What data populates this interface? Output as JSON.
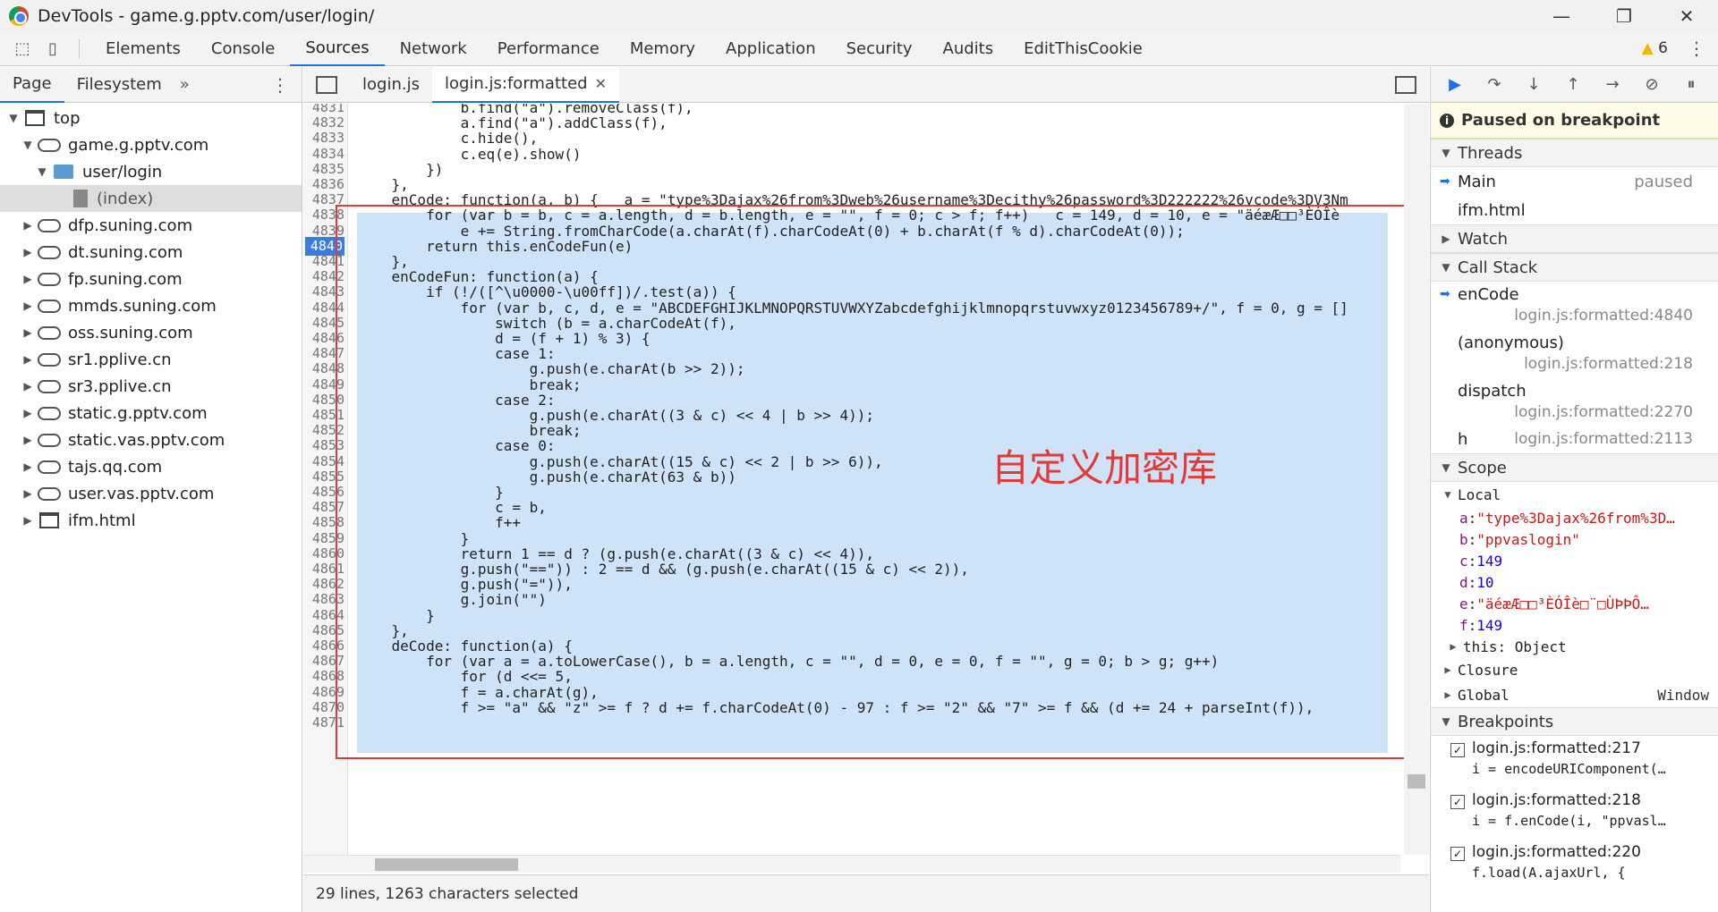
{
  "window": {
    "title": "DevTools - game.g.pptv.com/user/login/"
  },
  "main_tabs": [
    "Elements",
    "Console",
    "Sources",
    "Network",
    "Performance",
    "Memory",
    "Application",
    "Security",
    "Audits",
    "EditThisCookie"
  ],
  "active_tab": "Sources",
  "warnings": "6",
  "navigator": {
    "tabs": [
      "Page",
      "Filesystem"
    ],
    "tree": [
      {
        "label": "top",
        "level": 0,
        "kind": "frame",
        "expanded": true
      },
      {
        "label": "game.g.pptv.com",
        "level": 1,
        "kind": "cloud",
        "expanded": true
      },
      {
        "label": "user/login",
        "level": 2,
        "kind": "folder",
        "expanded": true
      },
      {
        "label": "(index)",
        "level": 3,
        "kind": "file",
        "selected": true
      },
      {
        "label": "dfp.suning.com",
        "level": 1,
        "kind": "cloud"
      },
      {
        "label": "dt.suning.com",
        "level": 1,
        "kind": "cloud"
      },
      {
        "label": "fp.suning.com",
        "level": 1,
        "kind": "cloud"
      },
      {
        "label": "mmds.suning.com",
        "level": 1,
        "kind": "cloud"
      },
      {
        "label": "oss.suning.com",
        "level": 1,
        "kind": "cloud"
      },
      {
        "label": "sr1.pplive.cn",
        "level": 1,
        "kind": "cloud"
      },
      {
        "label": "sr3.pplive.cn",
        "level": 1,
        "kind": "cloud"
      },
      {
        "label": "static.g.pptv.com",
        "level": 1,
        "kind": "cloud"
      },
      {
        "label": "static.vas.pptv.com",
        "level": 1,
        "kind": "cloud"
      },
      {
        "label": "tajs.qq.com",
        "level": 1,
        "kind": "cloud"
      },
      {
        "label": "user.vas.pptv.com",
        "level": 1,
        "kind": "cloud"
      },
      {
        "label": "ifm.html",
        "level": 1,
        "kind": "frame"
      }
    ]
  },
  "editor": {
    "tabs": [
      {
        "label": "login.js",
        "active": false
      },
      {
        "label": "login.js:formatted",
        "active": true
      }
    ],
    "first_line": 4831,
    "breakpoint_line": 4840,
    "lines": [
      "            b.find(\"a\").removeClass(f),",
      "            a.find(\"a\").addClass(f),",
      "            c.hide(),",
      "            c.eq(e).show()",
      "        })",
      "    },",
      "    enCode: function(a, b) {   a = \"type%3Dajax%26from%3Dweb%26username%3Decithy%26password%3D222222%26vcode%3DV3Nm",
      "        for (var b = b, c = a.length, d = b.length, e = \"\", f = 0; c > f; f++)   c = 149, d = 10, e = \"äéæÆ□□³ÈÓÎè",
      "            e += String.fromCharCode(a.charAt(f).charCodeAt(0) + b.charAt(f % d).charCodeAt(0));",
      "        return this.enCodeFun(e)",
      "    },",
      "    enCodeFun: function(a) {",
      "        if (!/([^\\u0000-\\u00ff])/.test(a)) {",
      "            for (var b, c, d, e = \"ABCDEFGHIJKLMNOPQRSTUVWXYZabcdefghijklmnopqrstuvwxyz0123456789+/\", f = 0, g = []",
      "                switch (b = a.charCodeAt(f),",
      "                d = (f + 1) % 3) {",
      "                case 1:",
      "                    g.push(e.charAt(b >> 2));",
      "                    break;",
      "                case 2:",
      "                    g.push(e.charAt((3 & c) << 4 | b >> 4));",
      "                    break;",
      "                case 0:",
      "                    g.push(e.charAt((15 & c) << 2 | b >> 6)),",
      "                    g.push(e.charAt(63 & b))",
      "                }",
      "                c = b,",
      "                f++",
      "            }",
      "            return 1 == d ? (g.push(e.charAt((3 & c) << 4)),",
      "            g.push(\"==\")) : 2 == d && (g.push(e.charAt((15 & c) << 2)),",
      "            g.push(\"=\")),",
      "            g.join(\"\")",
      "        }",
      "    },",
      "    deCode: function(a) {",
      "        for (var a = a.toLowerCase(), b = a.length, c = \"\", d = 0, e = 0, f = \"\", g = 0; b > g; g++)",
      "            for (d <<= 5,",
      "            f = a.charAt(g),",
      "            f >= \"a\" && \"z\" >= f ? d += f.charCodeAt(0) - 97 : f >= \"2\" && \"7\" >= f && (d += 24 + parseInt(f)),",
      ""
    ],
    "annotation": "自定义加密库",
    "status": "29 lines, 1263 characters selected"
  },
  "debugger": {
    "paused_message": "Paused on breakpoint",
    "sections": {
      "threads": "Threads",
      "watch": "Watch",
      "call_stack": "Call Stack",
      "scope": "Scope",
      "breakpoints": "Breakpoints"
    },
    "threads": [
      {
        "name": "Main",
        "status": "paused",
        "current": true
      },
      {
        "name": "ifm.html",
        "status": ""
      }
    ],
    "call_stack": [
      {
        "fn": "enCode",
        "loc": "login.js:formatted:4840",
        "current": true
      },
      {
        "fn": "(anonymous)",
        "loc": "login.js:formatted:218"
      },
      {
        "fn": "dispatch",
        "loc": "login.js:formatted:2270"
      },
      {
        "fn": "h",
        "loc": "login.js:formatted:2113"
      }
    ],
    "scope": {
      "local_label": "Local",
      "vars": [
        {
          "key": "a",
          "value": "\"type%3Dajax%26from%3D…",
          "kind": "str"
        },
        {
          "key": "b",
          "value": "\"ppvaslogin\"",
          "kind": "str"
        },
        {
          "key": "c",
          "value": "149",
          "kind": "num"
        },
        {
          "key": "d",
          "value": "10",
          "kind": "num"
        },
        {
          "key": "e",
          "value": "\"äéæÆ□□³ÈÓÎè□¨□ÙÞÞÔ…",
          "kind": "str"
        },
        {
          "key": "f",
          "value": "149",
          "kind": "num"
        }
      ],
      "this_label": "this: Object",
      "closure": "Closure",
      "global": "Global",
      "global_value": "Window"
    },
    "breakpoints": [
      {
        "file": "login.js:formatted:217",
        "src": "i = encodeURIComponent(…"
      },
      {
        "file": "login.js:formatted:218",
        "src": "i = f.enCode(i, \"ppvasl…"
      },
      {
        "file": "login.js:formatted:220",
        "src": "f.load(A.ajaxUrl, {"
      }
    ]
  }
}
